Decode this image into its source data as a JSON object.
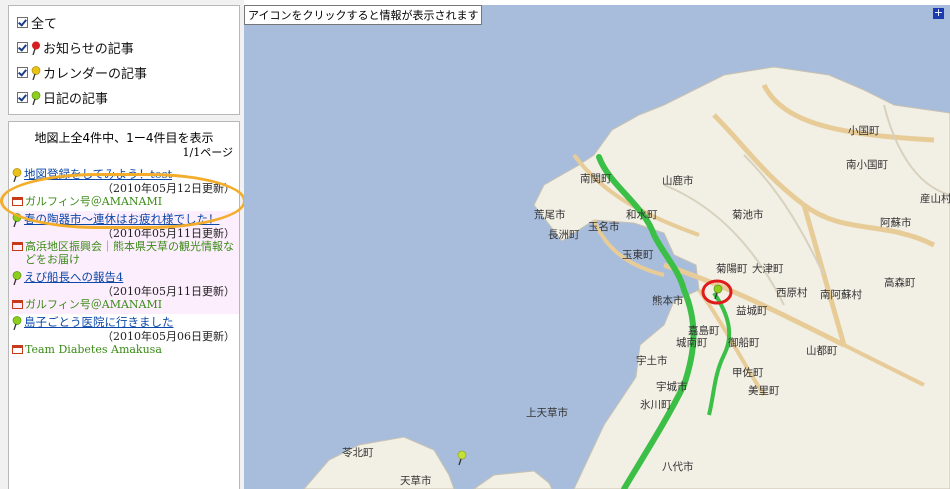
{
  "filters": [
    {
      "label": "全て",
      "checked": true,
      "pin_color": ""
    },
    {
      "label": "お知らせの記事",
      "checked": true,
      "pin_color": "#d81e1e"
    },
    {
      "label": "カレンダーの記事",
      "checked": true,
      "pin_color": "#e8c21a"
    },
    {
      "label": "日記の記事",
      "checked": true,
      "pin_color": "#8ccd1e"
    }
  ],
  "list": {
    "summary": "地図上全4件中、1ー4件目を表示",
    "page": "1/1ページ",
    "entries": [
      {
        "title": "地図登録をしてみよう！test",
        "date": "（2010年05月12日更新）",
        "blog": "ガルフィン号＠AMANAMI"
      },
      {
        "title": "春の陶器市〜連休はお疲れ様でした！",
        "date": "（2010年05月11日更新）",
        "blog": "高浜地区振興会｜熊本県天草の観光情報などをお届け"
      },
      {
        "title": "えび船長への報告4",
        "date": "（2010年05月11日更新）",
        "blog": "ガルフィン号＠AMANAMI"
      },
      {
        "title": "島子ごとう医院に行きました",
        "date": "（2010年05月06日更新）",
        "blog": "Team Diabetes Amakusa"
      }
    ]
  },
  "map": {
    "hint": "アイコンをクリックすると情報が表示されます",
    "expand_symbol": "+",
    "towns": [
      "小国町",
      "南小国町",
      "産山村",
      "南関町",
      "山鹿市",
      "荒尾市",
      "和水町",
      "菊池市",
      "阿蘇市",
      "長洲町",
      "玉名市",
      "玉東町",
      "菊陽町",
      "大津町",
      "高森町",
      "熊本市",
      "西原村",
      "南阿蘇村",
      "益城町",
      "嘉島町",
      "城南町",
      "御船町",
      "山都町",
      "宇土市",
      "甲佐町",
      "美里町",
      "宇城市",
      "氷川町",
      "上天草市",
      "苓北町",
      "八代市",
      "天草市"
    ]
  },
  "colors": {
    "accent_link": "#0b48a8",
    "blog_green": "#3a8b17",
    "highlight_orange": "#f3ad2a",
    "circle_red": "#e01b1b",
    "route_green": "#3cbf46"
  }
}
